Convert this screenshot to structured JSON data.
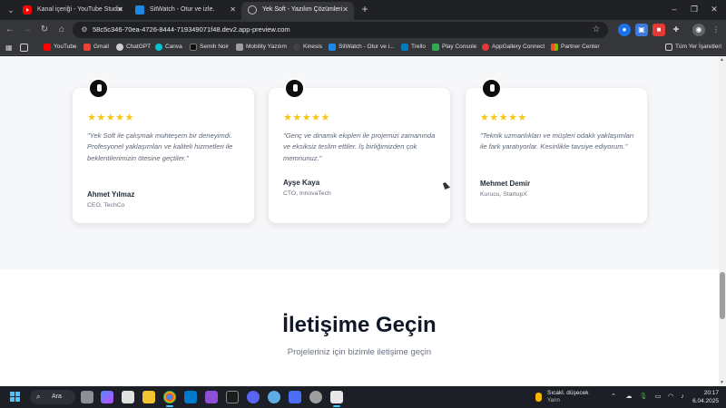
{
  "browser": {
    "tabs": [
      {
        "title": "Kanal içeriği - YouTube Studio",
        "active": false
      },
      {
        "title": "SitWatch - Otur ve izle.",
        "active": false
      },
      {
        "title": "Yek Soft - Yazılım Çözümleri",
        "active": true
      }
    ],
    "new_tab": "+",
    "url": "58c5c346-70ea-4726-8444-719349071f48.dev2.app-preview.com",
    "bookmarks": [
      "YouTube",
      "Gmail",
      "ChatGPT",
      "Canva",
      "Semih Noir",
      "Mobility Yazılım",
      "Kinesis",
      "SitWatch - Otur ve i...",
      "Trello",
      "Play Console",
      "AppGallery Connect",
      "Partner Center"
    ],
    "all_bookmarks": "Tüm Yer İşaretleri"
  },
  "testimonials": [
    {
      "stars": "★★★★★",
      "quote": "\"Yek Soft ile çalışmak muhteşem bir deneyimdi. Profesyonel yaklaşımları ve kaliteli hizmetleri ile beklentilerimizin ötesine geçtiler.\"",
      "name": "Ahmet Yılmaz",
      "role": "CEO, TechCo"
    },
    {
      "stars": "★★★★★",
      "quote": "\"Genç ve dinamik ekipleri ile projemizi zamanında ve eksiksiz teslim ettiler. İş birliğimizden çok memnunuz.\"",
      "name": "Ayşe Kaya",
      "role": "CTO, InnovaTech"
    },
    {
      "stars": "★★★★★",
      "quote": "\"Teknik uzmanlıkları ve müşteri odaklı yaklaşımları ile fark yaratıyorlar. Kesinlikle tavsiye ediyorum.\"",
      "name": "Mehmet Demir",
      "role": "Kurucu, StartupX"
    }
  ],
  "contact": {
    "title": "İletişime Geçin",
    "subtitle": "Projeleriniz için bizimle iletişime geçin"
  },
  "taskbar": {
    "search_label": "Ara",
    "weather_text": "Sıcakl. düşecek",
    "weather_sub": "Yarın",
    "time": "20:17",
    "date": "6.04.2025"
  },
  "colors": {
    "star": "#f5c518",
    "heading": "#111827",
    "accent": "#4cc2ff"
  }
}
